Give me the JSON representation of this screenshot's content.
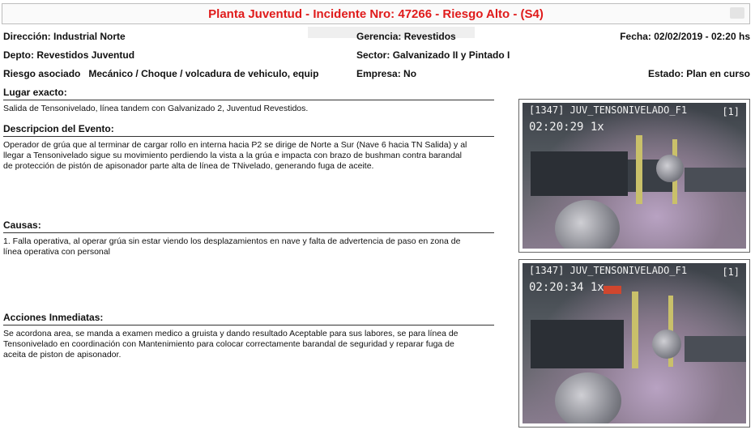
{
  "header": {
    "title": "Planta Juventud - Incidente Nro: 47266  - Riesgo Alto - (S4)"
  },
  "fields": {
    "direccion": {
      "label": "Dirección:",
      "value": "Industrial Norte"
    },
    "gerencia": {
      "label": "Gerencia:",
      "value": "Revestidos"
    },
    "fecha": {
      "label": "Fecha:",
      "value": "02/02/2019 - 02:20 hs"
    },
    "depto": {
      "label": "Depto:",
      "value": "Revestidos Juventud"
    },
    "sector": {
      "label": "Sector:",
      "value": "Galvanizado II y Pintado I"
    },
    "riesgo": {
      "label": "Riesgo asociado",
      "value": "Mecánico / Choque / volcadura de vehiculo, equip"
    },
    "empresa": {
      "label": "Empresa:",
      "value": "No"
    },
    "estado": {
      "label": "Estado:",
      "value": "Plan en curso"
    }
  },
  "sections": {
    "lugar": {
      "heading": "Lugar exacto:",
      "text": "Salida de Tensonivelado, línea tandem con Galvanizado 2, Juventud Revestidos."
    },
    "descripcion": {
      "heading": "Descripcion del Evento:",
      "text": "Operador de grúa que al terminar de cargar rollo en interna hacia P2 se dirige de Norte a Sur (Nave 6  hacia TN Salida) y al llegar a Tensonivelado sigue su movimiento perdiendo la vista a la grúa e  impacta con brazo de bushman contra barandal de protección de pistón de apisonador parte alta de línea de TNivelado,  generando fuga de aceite."
    },
    "causas": {
      "heading": "Causas:",
      "text": "1. Falla operativa, al operar grúa sin estar viendo los desplazamientos en nave y falta  de advertencia de paso en zona de línea operativa con personal"
    },
    "acciones": {
      "heading": "Acciones Inmediatas:",
      "text": "Se acordona area, se manda a examen medico a gruista y dando resultado Aceptable para sus labores, se para línea de Tensonivelado en coordinación con Mantenimiento para colocar correctamente barandal de seguridad y reparar fuga de aceita de piston de apisonador."
    }
  },
  "cameras": [
    {
      "label": "[1347] JUV_TENSONIVELADO_F1",
      "num": "[1]",
      "time": "02:20:29 1x"
    },
    {
      "label": "[1347] JUV_TENSONIVELADO_F1",
      "num": "[1]",
      "time": "02:20:34 1x"
    }
  ]
}
